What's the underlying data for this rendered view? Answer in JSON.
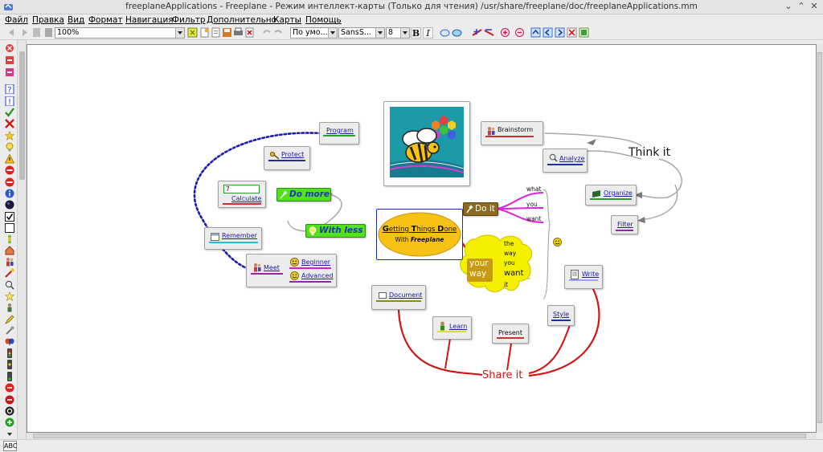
{
  "window": {
    "title": "freeplaneApplications - Freeplane - Режим интеллект-карты (Только для чтения) /usr/share/freeplane/doc/freeplaneApplications.mm",
    "controls": [
      "minimize-icon",
      "maximize-icon",
      "close-icon"
    ]
  },
  "menu": [
    "Файл",
    "Правка",
    "Вид",
    "Формат",
    "Навигация",
    "Фильтр",
    "Дополнительно",
    "Карты",
    "Помощь"
  ],
  "toolbar": {
    "zoom_value": "100%",
    "style_value": "По умо...",
    "font_value": "SansS...",
    "size_value": "8",
    "bold_label": "B",
    "italic_label": "I"
  },
  "statusbar": {
    "spell_label": "ABC"
  },
  "map": {
    "root": {
      "title_parts": [
        "G",
        "etting ",
        "T",
        "hings ",
        "D",
        "one"
      ],
      "subtitle_prefix": "With ",
      "subtitle_brand": "Freeplane"
    },
    "nodes": {
      "program": "Program",
      "protect": "Protect",
      "calculate_value": "7",
      "calculate": "Calculate",
      "remember": "Remember",
      "meet": "Meet",
      "beginner": "Beginner",
      "advanced": "Advanced",
      "do_more": "Do more",
      "with_less": "With less",
      "do_it": "Do it",
      "brainstorm": "Brainstorm",
      "analyze": "Analyze",
      "organize": "Organize",
      "filter": "Filter",
      "write": "Write",
      "style": "Style",
      "document": "Document",
      "learn": "Learn",
      "present": "Present",
      "think_it": "Think it",
      "share_it": "Share it",
      "your_way_1": "your",
      "your_way_2": "way",
      "do_it_leaves": [
        "what",
        "you",
        "want"
      ],
      "cloud_leaves": [
        "the",
        "way",
        "you",
        "want",
        "it"
      ]
    }
  },
  "colors": {
    "connector_blue": "#1a1ab0",
    "share_red": "#d21414",
    "think_gray": "#a8a8a8",
    "do_it_magenta": "#e020e0",
    "root_fill": "#f7c215",
    "green_node": "#54e01a"
  }
}
